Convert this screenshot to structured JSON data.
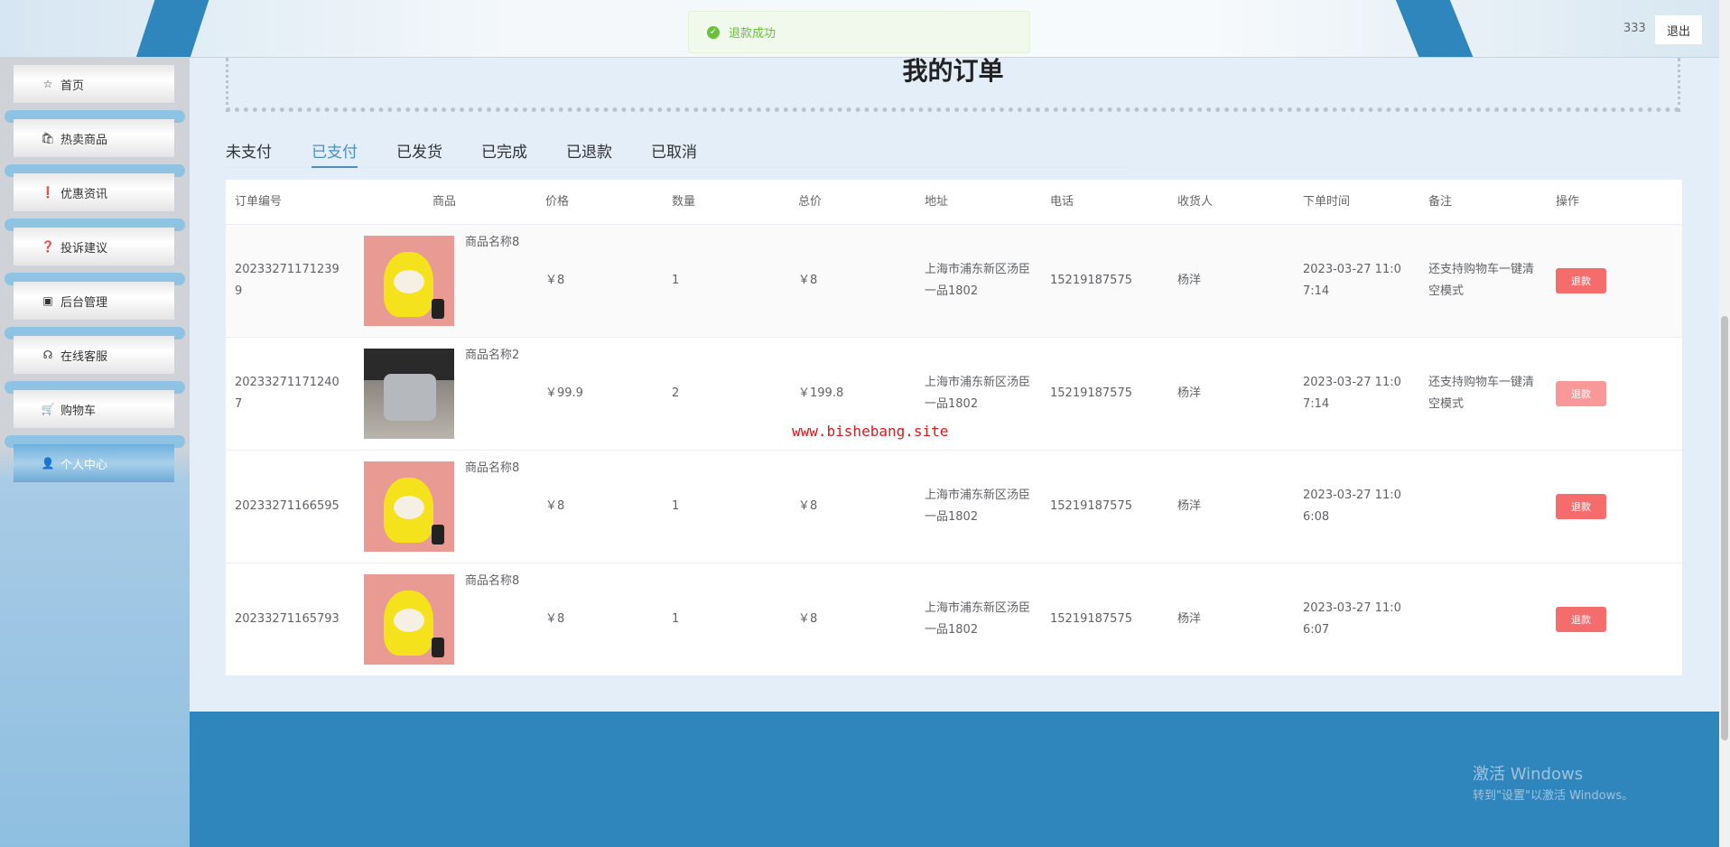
{
  "toast": {
    "message": "退款成功",
    "icon": "check-circle-icon"
  },
  "header": {
    "username": "333",
    "logout_label": "退出"
  },
  "sidebar": {
    "items": [
      {
        "label": "首页",
        "icon": "☆"
      },
      {
        "label": "热卖商品",
        "icon": "🛍"
      },
      {
        "label": "优惠资讯",
        "icon": "❗"
      },
      {
        "label": "投诉建议",
        "icon": "❓"
      },
      {
        "label": "后台管理",
        "icon": "▣"
      },
      {
        "label": "在线客服",
        "icon": "☊"
      },
      {
        "label": "购物车",
        "icon": "🛒"
      },
      {
        "label": "个人中心",
        "icon": "👤"
      }
    ]
  },
  "page": {
    "title": "我的订单"
  },
  "tabs": [
    "未支付",
    "已支付",
    "已发货",
    "已完成",
    "已退款",
    "已取消"
  ],
  "active_tab": "已支付",
  "table": {
    "headers": [
      "订单编号",
      "商品",
      "价格",
      "数量",
      "总价",
      "地址",
      "电话",
      "收货人",
      "下单时间",
      "备注",
      "操作"
    ],
    "rows": [
      {
        "order_no": "20233271171239\n9",
        "product": "商品名称8",
        "price": "￥8",
        "qty": "1",
        "total": "￥8",
        "address": "上海市浦东新区汤臣一品1802",
        "phone": "15219187575",
        "receiver": "杨洋",
        "time": "2023-03-27 11:07:14",
        "note": "还支持购物车一键清空模式",
        "action": "退款"
      },
      {
        "order_no": "20233271171240\n7",
        "product": "商品名称2",
        "price": "￥99.9",
        "qty": "2",
        "total": "￥199.8",
        "address": "上海市浦东新区汤臣一品1802",
        "phone": "15219187575",
        "receiver": "杨洋",
        "time": "2023-03-27 11:07:14",
        "note": "还支持购物车一键清空模式",
        "action": "退款"
      },
      {
        "order_no": "20233271166595",
        "product": "商品名称8",
        "price": "￥8",
        "qty": "1",
        "total": "￥8",
        "address": "上海市浦东新区汤臣一品1802",
        "phone": "15219187575",
        "receiver": "杨洋",
        "time": "2023-03-27 11:06:08",
        "note": "",
        "action": "退款"
      },
      {
        "order_no": "20233271165793",
        "product": "商品名称8",
        "price": "￥8",
        "qty": "1",
        "total": "￥8",
        "address": "上海市浦东新区汤臣一品1802",
        "phone": "15219187575",
        "receiver": "杨洋",
        "time": "2023-03-27 11:06:07",
        "note": "",
        "action": "退款"
      }
    ]
  },
  "watermark": "www.bishebang.site",
  "windows": {
    "line1": "激活 Windows",
    "line2": "转到\"设置\"以激活 Windows。"
  }
}
